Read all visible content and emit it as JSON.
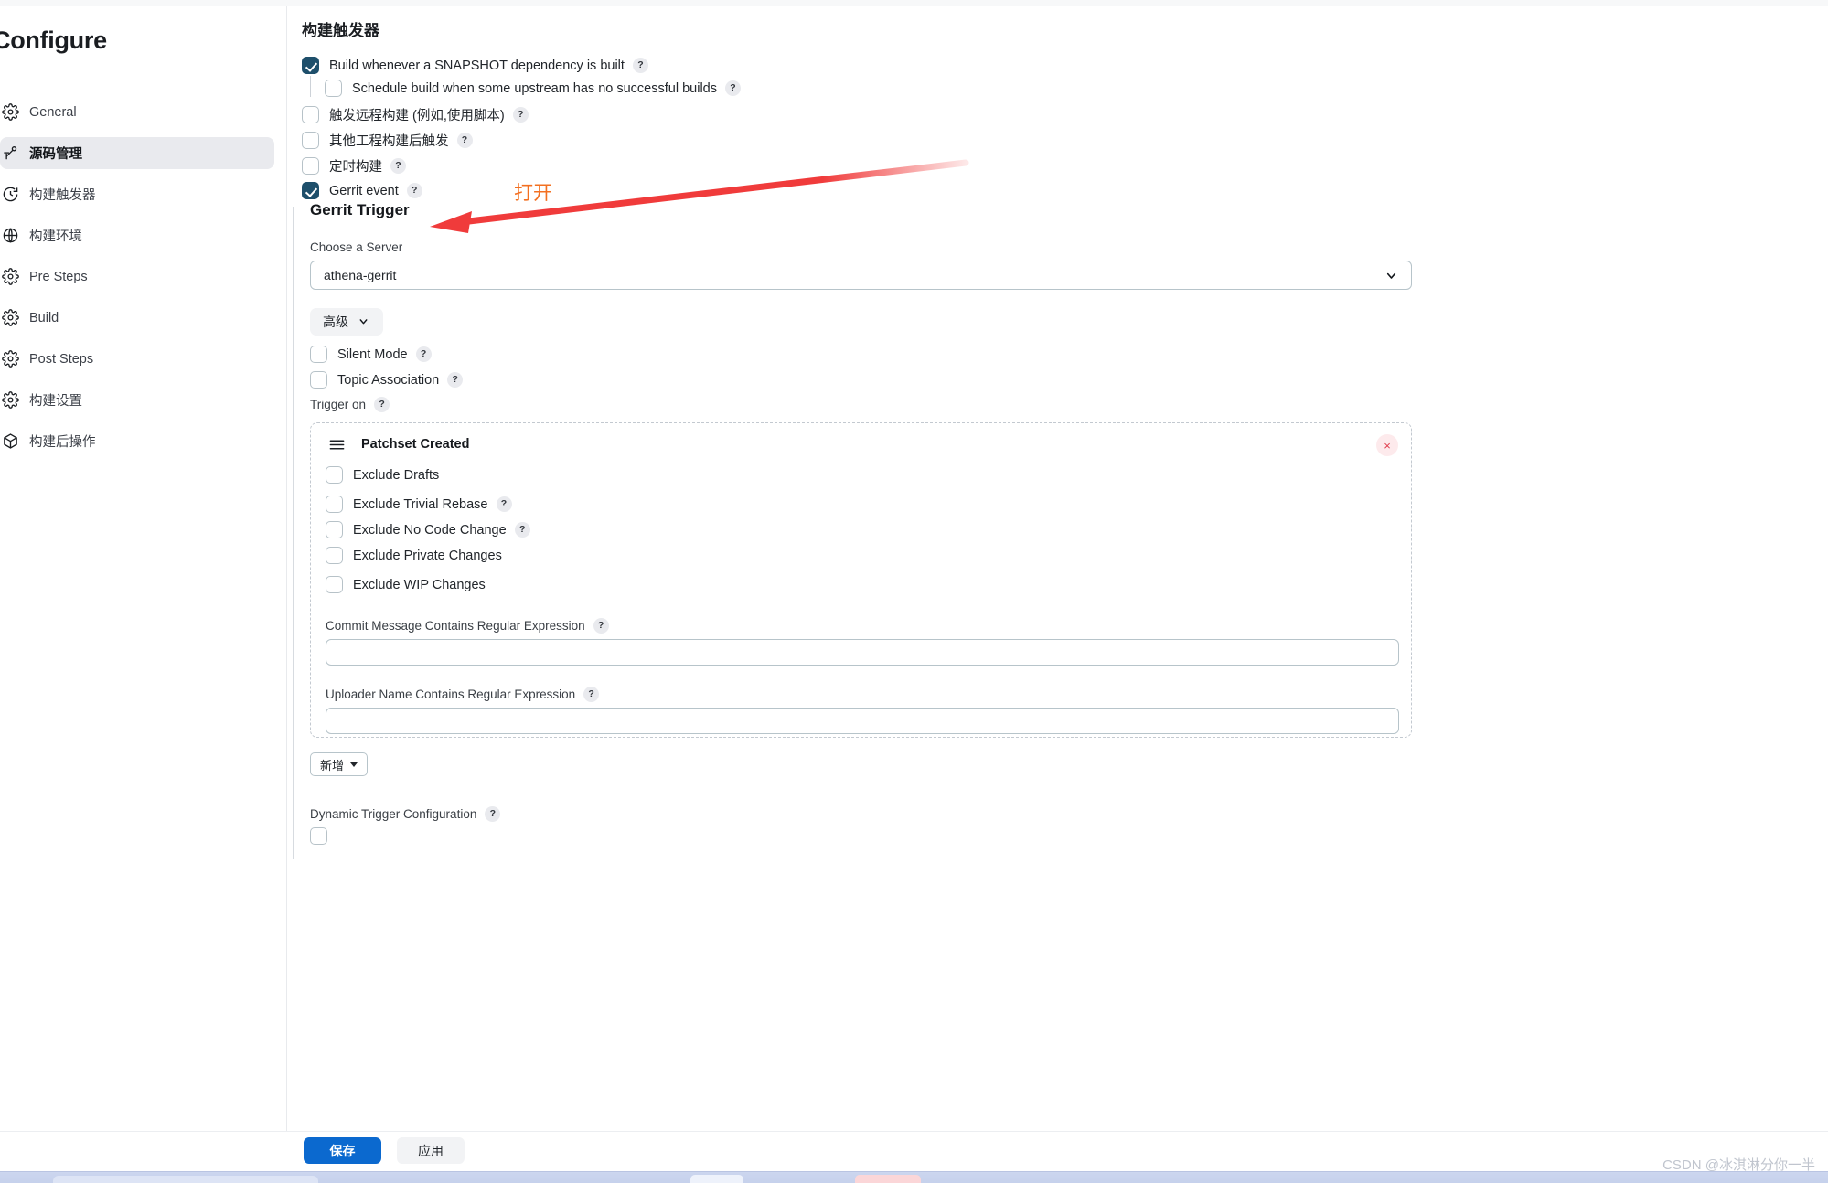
{
  "sidebar": {
    "title": "Configure",
    "items": [
      {
        "label": "General",
        "icon": "gear-icon",
        "active": false
      },
      {
        "label": "源码管理",
        "icon": "source-control-icon",
        "active": true
      },
      {
        "label": "构建触发器",
        "icon": "clock-icon",
        "active": false
      },
      {
        "label": "构建环境",
        "icon": "globe-icon",
        "active": false
      },
      {
        "label": "Pre Steps",
        "icon": "gear-icon",
        "active": false
      },
      {
        "label": "Build",
        "icon": "gear-icon",
        "active": false
      },
      {
        "label": "Post Steps",
        "icon": "gear-icon",
        "active": false
      },
      {
        "label": "构建设置",
        "icon": "gear-icon",
        "active": false
      },
      {
        "label": "构建后操作",
        "icon": "cube-icon",
        "active": false
      }
    ]
  },
  "main": {
    "heading": "构建触发器",
    "triggers": [
      {
        "label": "Build whenever a SNAPSHOT dependency is built",
        "checked": true,
        "help": "?"
      },
      {
        "label": "Schedule build when some upstream has no successful builds",
        "checked": false,
        "help": "?"
      },
      {
        "label": "触发远程构建 (例如,使用脚本)",
        "checked": false,
        "help": "?"
      },
      {
        "label": "其他工程构建后触发",
        "checked": false,
        "help": "?"
      },
      {
        "label": "定时构建",
        "checked": false,
        "help": "?"
      },
      {
        "label": "Gerrit event",
        "checked": true,
        "help": "?"
      }
    ]
  },
  "gerrit": {
    "section_title": "Gerrit Trigger",
    "server_label": "Choose a Server",
    "server_value": "athena-gerrit",
    "advanced_button": "高级",
    "silent_mode": {
      "label": "Silent Mode",
      "checked": false,
      "help": "?"
    },
    "topic_association": {
      "label": "Topic Association",
      "checked": false,
      "help": "?"
    },
    "trigger_on_label": "Trigger on",
    "trigger_on_help": "?",
    "panel": {
      "title": "Patchset Created",
      "close_label": "×",
      "checkboxes": [
        {
          "label": "Exclude Drafts",
          "checked": false,
          "help": ""
        },
        {
          "label": "Exclude Trivial Rebase",
          "checked": false,
          "help": "?"
        },
        {
          "label": "Exclude No Code Change",
          "checked": false,
          "help": "?"
        },
        {
          "label": "Exclude Private Changes",
          "checked": false,
          "help": ""
        },
        {
          "label": "Exclude WIP Changes",
          "checked": false,
          "help": ""
        }
      ],
      "fields": [
        {
          "label": "Commit Message Contains Regular Expression",
          "help": "?",
          "value": "",
          "placeholder": ""
        },
        {
          "label": "Uploader Name Contains Regular Expression",
          "help": "?",
          "value": "",
          "placeholder": ""
        }
      ]
    },
    "add_button": "新增",
    "dynamic_trigger": {
      "label": "Dynamic Trigger Configuration",
      "help": "?",
      "checked": false
    }
  },
  "footer": {
    "save_label": "保存",
    "apply_label": "应用"
  },
  "annotation": {
    "text": "打开",
    "color": "#f37021",
    "arrow_color": "#f03b3b"
  },
  "watermark": "CSDN @冰淇淋分你一半",
  "colors": {
    "accent_primary": "#0b69cf",
    "checkbox_checked": "#1e4f6b",
    "sidebar_active_bg": "#e9eaee",
    "border": "#b7c4ca",
    "danger": "#e03b4b"
  }
}
